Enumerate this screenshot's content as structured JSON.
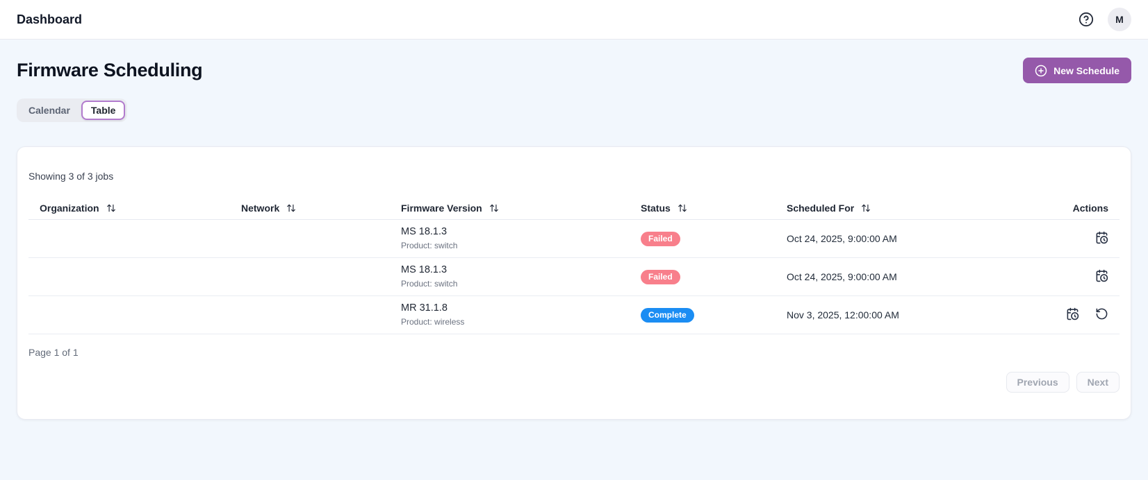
{
  "header": {
    "title": "Dashboard",
    "avatar_initial": "M"
  },
  "page": {
    "title": "Firmware Scheduling",
    "new_schedule_label": "New Schedule"
  },
  "tabs": [
    {
      "label": "Calendar",
      "active": false
    },
    {
      "label": "Table",
      "active": true
    }
  ],
  "table": {
    "summary": "Showing 3 of 3 jobs",
    "columns": [
      {
        "label": "Organization",
        "sortable": true
      },
      {
        "label": "Network",
        "sortable": true
      },
      {
        "label": "Firmware Version",
        "sortable": true
      },
      {
        "label": "Status",
        "sortable": true
      },
      {
        "label": "Scheduled For",
        "sortable": true
      },
      {
        "label": "Actions",
        "sortable": false
      }
    ],
    "rows": [
      {
        "organization": "",
        "network": "",
        "firmware_version": "MS 18.1.3",
        "product": "Product: switch",
        "status": "Failed",
        "status_color": "#f87f8b",
        "scheduled_for": "Oct 24, 2025, 9:00:00 AM",
        "actions": [
          "reschedule"
        ]
      },
      {
        "organization": "",
        "network": "",
        "firmware_version": "MS 18.1.3",
        "product": "Product: switch",
        "status": "Failed",
        "status_color": "#f87f8b",
        "scheduled_for": "Oct 24, 2025, 9:00:00 AM",
        "actions": [
          "reschedule"
        ]
      },
      {
        "organization": "",
        "network": "",
        "firmware_version": "MR 31.1.8",
        "product": "Product: wireless",
        "status": "Complete",
        "status_color": "#1b8df3",
        "scheduled_for": "Nov 3, 2025, 12:00:00 AM",
        "actions": [
          "reschedule",
          "retry"
        ]
      }
    ]
  },
  "pagination": {
    "label": "Page 1 of 1",
    "previous_label": "Previous",
    "next_label": "Next"
  },
  "icons": {
    "help": "circle-question-icon",
    "new_schedule": "circle-plus-icon",
    "sort": "arrow-up-down-icon",
    "reschedule": "calendar-clock-icon",
    "retry": "rotate-ccw-icon"
  },
  "colors": {
    "accent_purple": "#9559aa",
    "tab_ring_purple": "#b27bcd",
    "failed_badge": "#f87f8b",
    "complete_badge": "#1b8df3",
    "page_background": "#f2f7fd"
  }
}
